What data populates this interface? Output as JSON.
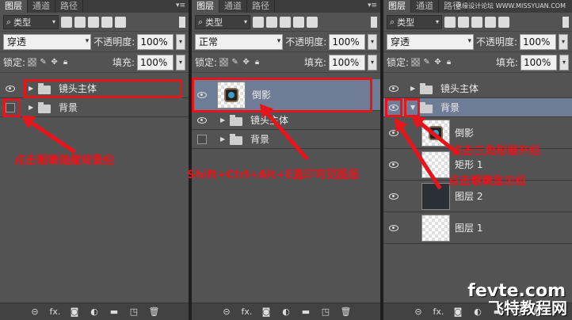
{
  "tabs": [
    "图层",
    "通道",
    "路径"
  ],
  "panels": [
    {
      "kind": "类型",
      "blend": "穿透",
      "opacity_label": "不透明度:",
      "opacity": "100%",
      "lock_label": "锁定:",
      "fill_label": "填充:",
      "fill": "100%",
      "layers": [
        "镜头主体",
        "背景"
      ],
      "note": "点击眼睛隐藏背景组"
    },
    {
      "kind": "类型",
      "blend": "正常",
      "opacity_label": "不透明度:",
      "opacity": "100%",
      "lock_label": "锁定:",
      "fill_label": "填充:",
      "fill": "100%",
      "layers": [
        "倒影",
        "镜头主体",
        "背景"
      ],
      "note": "Shift+Ctrl+Alt+E盖印可见图层"
    },
    {
      "kind": "类型",
      "blend": "穿透",
      "opacity_label": "不透明度:",
      "opacity": "100%",
      "lock_label": "锁定:",
      "fill_label": "填充:",
      "fill": "100%",
      "layers": [
        "镜头主体",
        "背景",
        "倒影",
        "矩形 1",
        "图层 2",
        "图层 1"
      ],
      "note1": "点击三角形展开组",
      "note2": "点击眼睛显示组"
    }
  ],
  "footer_icons": [
    "link-icon",
    "fx-icon",
    "mask-icon",
    "adjustment-icon",
    "group-icon",
    "new-layer-icon",
    "trash-icon"
  ],
  "footer_fx": "fx.",
  "watermark_top": "思缘设计论坛 WWW.MISSYUAN.COM",
  "watermark_site": "fevte.com",
  "watermark_cn": "飞特教程网",
  "colors": {
    "accent_red": "#e8141b",
    "selected": "#6f7c95",
    "panel": "#535353"
  }
}
